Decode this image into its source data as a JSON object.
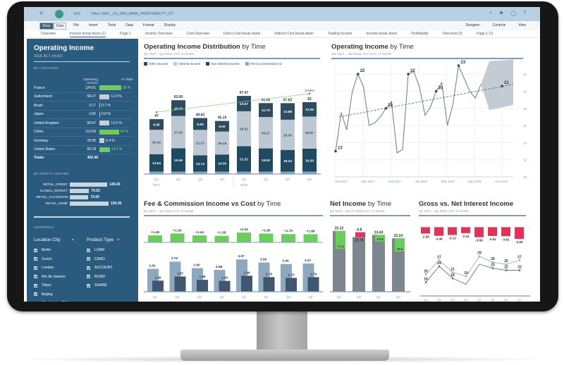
{
  "shell": {
    "app_name": "SSS",
    "breadcrumb": "Files  /  SAP__FS_SDN_BANK_PROFITABILITY_V1*",
    "icons": [
      "search-icon",
      "notifications-icon",
      "chat-icon",
      "help-icon"
    ],
    "notification_count": "2"
  },
  "toolbar": {
    "story_label": "Story",
    "data_label": "Data",
    "menus": [
      "File",
      "Insert",
      "Tools",
      "Data",
      "Format",
      "Display"
    ],
    "right": [
      "Designer",
      "Controls",
      "View"
    ]
  },
  "page_tabs": [
    "Overview",
    "Income break down (1)",
    "Page 1",
    "Income Overview",
    "Cost Overview",
    "Direct Cost break-down",
    "Indirect Cost break-down",
    "Trading Income",
    "Income break-down",
    "Profitability",
    "Overview (2)",
    "Page 1 (1)"
  ],
  "active_tab": "Income break down (1)",
  "left_panel": {
    "title": "Operating Income",
    "subtitle": "2018, ACT, mUSD",
    "by_location_label": "BY LOCATION",
    "col_value": "Operating Income",
    "col_pct": "% Total",
    "rows": [
      {
        "name": "France",
        "value": "124.61",
        "pct": "28 %",
        "share": 0.28,
        "highlight": true
      },
      {
        "name": "Switzerland",
        "value": "58.27",
        "pct": "12.9 %",
        "share": 0.129,
        "highlight": false
      },
      {
        "name": "Brazil",
        "value": "3.17",
        "pct": "0.7 %",
        "share": 0.007,
        "highlight": false
      },
      {
        "name": "Japan",
        "value": "3.65",
        "pct": "0.8 %",
        "share": 0.008,
        "highlight": false
      },
      {
        "name": "United Kingdom",
        "value": "58.97",
        "pct": "13.0 %",
        "share": 0.13,
        "highlight": false
      },
      {
        "name": "China",
        "value": "113.69",
        "pct": "25 %",
        "share": 0.25,
        "highlight": true
      },
      {
        "name": "Germany",
        "value": "28.95",
        "pct": "6.4 %",
        "share": 0.064,
        "highlight": false
      },
      {
        "name": "United States",
        "value": "60.78",
        "pct": "13.4 %",
        "share": 0.134,
        "highlight": true
      }
    ],
    "total_label": "Totals",
    "total_value": "452.48",
    "by_profit_center_label": "BY PROFIT CENTER",
    "profit_centers": [
      {
        "name": "RETAIL_CREDIT",
        "value": "145.60",
        "num": 145.6
      },
      {
        "name": "GLOBAL_MARKET",
        "value": "74.53",
        "num": 74.53
      },
      {
        "name": "RETAIL_ACCOUNTIN",
        "value": "72.00",
        "num": 72.0
      },
      {
        "name": "RETAIL_HOME",
        "value": "150.36",
        "num": 150.36
      }
    ],
    "controls_label": "CONTROLS",
    "location_city_label": "Location City",
    "product_type_label": "Product Type",
    "cities": [
      "Berlin",
      "Zurich",
      "London",
      "Rio de Janeiro",
      "Tokyo",
      "Beijing",
      "Washington DC"
    ],
    "products": [
      "LOAN",
      "CARD",
      "ACCOUNT",
      "BOND",
      "SHARE"
    ]
  },
  "chart_data": [
    {
      "id": "op-income-distribution",
      "type": "bar",
      "title_bold": "Operating Income Distribution",
      "title_rest": " by Time",
      "subtitle": "Q1 2017... Q4 2018, ACT, in mUSD",
      "categories": [
        "Q1",
        "Q2",
        "Q3",
        "Q4",
        "Q1",
        "Q2",
        "Q3",
        "Q4"
      ],
      "year_labels": [
        "2017",
        "2018"
      ],
      "legend": [
        "Other Income",
        "Interest Income",
        "Non Interest Income",
        "Fee & Commission Inc"
      ],
      "colors": {
        "other": "#2d4c61",
        "interest": "#bdc8d3",
        "non_interest": "#1f4a62",
        "fee": "#89a6bf",
        "trend": "#86d07a"
      },
      "series": [
        {
          "name": "Fee & Commission Inc",
          "values": [
            2,
            2,
            2,
            2,
            2,
            2,
            2,
            2
          ]
        },
        {
          "name": "Non Interest Income",
          "values": [
            14.64,
            19.65,
            13.74,
            14.39,
            21.32,
            19.5,
            18.24,
            19.3
          ]
        },
        {
          "name": "Interest Income",
          "values": [
            20.42,
            27.02,
            21.27,
            19.19,
            29.31,
            26.27,
            25.3,
            26.87
          ]
        },
        {
          "name": "Other Income",
          "values": [
            8.95,
            13.22,
            9.93,
            8.92,
            12.87,
            11.7,
            13.88,
            12.06
          ]
        }
      ],
      "totals": [
        "47",
        "62.60",
        "49.83",
        "45.19",
        "67.47",
        "61.06",
        "57.82",
        "62"
      ],
      "trend_label": "4.02%",
      "ylim": [
        0,
        75
      ]
    },
    {
      "id": "op-income-by-time",
      "type": "line",
      "title_bold": "Operating Income",
      "title_rest": " by Time",
      "subtitle": "Jan 2017... Jan 2019, ACT & FC, in mUSD",
      "x_labels": [
        "Jan 2017",
        "May 2017",
        "Sep 2017",
        "Jan 2018",
        "May 2018",
        "Sep 2018",
        "Jan 2019"
      ],
      "y_ticks": [
        10,
        12,
        14,
        16,
        18,
        20,
        22
      ],
      "ylim": [
        10,
        23
      ],
      "values": [
        13,
        17.5,
        15.5,
        20,
        22,
        20.5,
        16,
        16.3,
        17,
        18,
        18.8,
        12.8,
        13.2,
        22,
        22.3,
        20.5,
        17.2,
        18.2,
        20,
        21,
        16,
        18.5,
        23,
        21.5,
        20,
        19.2,
        20.8
      ],
      "labeled_points": [
        {
          "index": 0,
          "label": "13"
        },
        {
          "index": 4,
          "label": "22"
        },
        {
          "index": 9,
          "label": "18"
        },
        {
          "index": 13,
          "label": "22"
        },
        {
          "index": 18,
          "label": "20"
        },
        {
          "index": 22,
          "label": "23"
        }
      ],
      "forecast": {
        "point_label": "21",
        "value": 20.6,
        "upper": 22.5,
        "lower": 18.4
      },
      "trend": [
        17,
        20.8
      ]
    },
    {
      "id": "fee-commission-vs-cost",
      "type": "bar",
      "title_bold": "Fee & Commission Income vs Cost",
      "title_rest": " by Time",
      "subtitle": "Q1 2017... Q4 2018, ACT, in mUSD",
      "categories": [
        "Q1",
        "Q2",
        "Q3",
        "Q4",
        "Q1",
        "Q2",
        "Q3",
        "Q4"
      ],
      "variance": [
        1.45,
        1.83,
        1.44,
        1.35,
        2.02,
        1.8,
        1.7,
        1.68
      ],
      "variance_labels": [
        "+1.45",
        "+1.83",
        "+1.44",
        "+1.35",
        "+2.02",
        "+1.80",
        "+1.70",
        "+1.68"
      ],
      "series": [
        {
          "name": "Income",
          "values": [
            2.81,
            3.7,
            2.9,
            2.68,
            3.97,
            3.59,
            3.4,
            3.47
          ],
          "labels": [
            "2.81",
            "3.70",
            "2.90",
            "2.68",
            "3.97",
            "3.59",
            "3.40",
            "3.47"
          ]
        },
        {
          "name": "Cost",
          "values": [
            1.36,
            1.87,
            1.46,
            1.33,
            1.96,
            1.79,
            1.7,
            1.79
          ],
          "labels": [
            "1.36",
            "1.87",
            "1.46",
            "1.33",
            "1.96",
            "1.79",
            "1.70",
            "1.79"
          ]
        }
      ],
      "ylim": [
        0,
        4.5
      ]
    },
    {
      "id": "net-income-by-time",
      "type": "bar",
      "title_bold": "Net Income",
      "title_rest": " by Time",
      "subtitle": "Q1 2018... Q4 (% 2018) ACT, in mUSD",
      "categories": [
        "Q1",
        "Q2",
        "Q3",
        "Q4"
      ],
      "values": [
        25.32,
        22.78,
        23.69,
        22.24
      ],
      "labels": [
        "25.32",
        "22.78",
        "23.69",
        "22.24"
      ],
      "deltas": [
        7.5,
        -0.8,
        2.8,
        5.5
      ],
      "delta_labels": [
        "+7.5",
        "-0.8",
        "+2.8",
        "+5.5"
      ],
      "ylim": [
        0,
        27
      ]
    },
    {
      "id": "gross-vs-net-interest",
      "type": "line",
      "title_bold": "Gross vs. Net Interest Income",
      "title_rest": "",
      "subtitle": "Q1 2017... Q4 2018, ACT, in mUSD",
      "categories": [
        "Q1",
        "Q2",
        "Q3",
        "Q4",
        "Q1",
        "Q2",
        "Q3",
        "Q4"
      ],
      "diff_values": [
        -2.59,
        -3.46,
        -3.13,
        -2.41,
        -3.99,
        -3.51,
        -3.61,
        -4.63
      ],
      "diff_labels": [
        "-2.59",
        "-3.46",
        "-3.13",
        "-2.41",
        "-3.99",
        "-3.51",
        "-3.61",
        "-4.63"
      ],
      "series": [
        {
          "name": "Gross",
          "values": [
            20,
            27,
            21,
            19,
            29,
            26,
            25,
            27
          ],
          "labels": [
            "20",
            "27",
            "21",
            "19",
            "29",
            "26",
            "25",
            "27"
          ]
        },
        {
          "name": "Net",
          "values": [
            16,
            24,
            18,
            15,
            25,
            23,
            22,
            22
          ],
          "labels": [
            "16",
            "24",
            "18",
            "",
            "",
            "23",
            "22",
            "22"
          ]
        }
      ],
      "ylim": [
        12,
        31
      ]
    }
  ]
}
